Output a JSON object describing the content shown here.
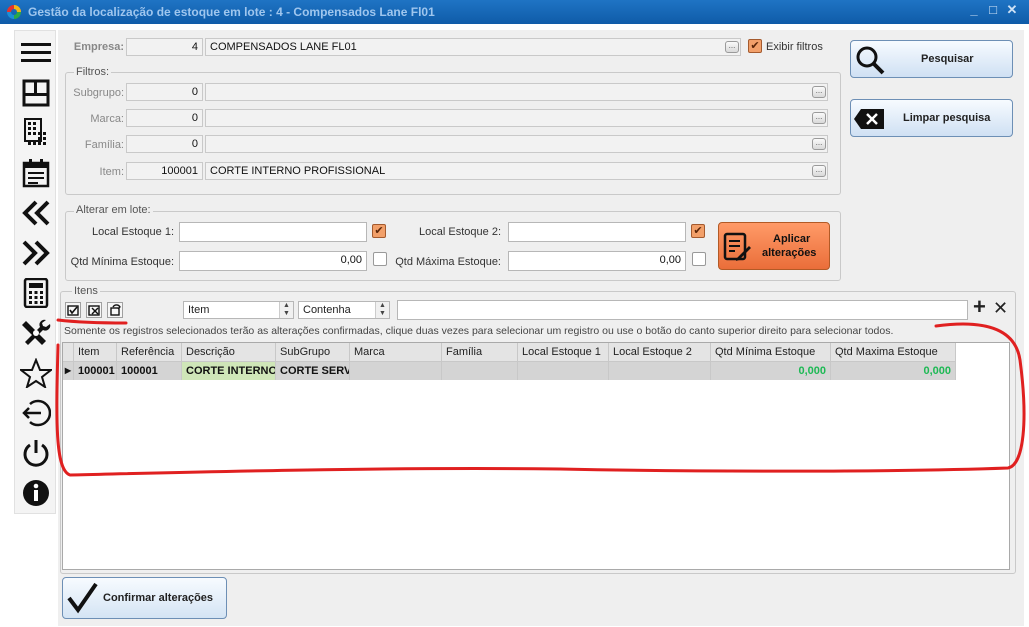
{
  "window": {
    "title": "Gestão da localização de estoque em lote : 4 - Compensados Lane Fl01",
    "controls": [
      "_",
      "□",
      "✕"
    ]
  },
  "sidebar": {
    "items": [
      {
        "name": "menu-icon"
      },
      {
        "name": "layout-icon"
      },
      {
        "name": "grid-calculator-icon"
      },
      {
        "name": "calendar-icon"
      },
      {
        "name": "double-chevron-left-icon"
      },
      {
        "name": "double-chevron-right-icon"
      },
      {
        "name": "calculator-icon"
      },
      {
        "name": "tools-icon"
      },
      {
        "name": "star-icon"
      },
      {
        "name": "exit-icon"
      },
      {
        "name": "power-icon"
      },
      {
        "name": "info-icon"
      }
    ]
  },
  "empresa": {
    "label": "Empresa:",
    "code": "4",
    "name": "COMPENSADOS LANE FL01",
    "show_filters_label": "Exibir filtros",
    "show_filters_checked": true
  },
  "filtros": {
    "title": "Filtros:",
    "subgrupo": {
      "label": "Subgrupo:",
      "code": "0",
      "desc": ""
    },
    "marca": {
      "label": "Marca:",
      "code": "0",
      "desc": ""
    },
    "familia": {
      "label": "Família:",
      "code": "0",
      "desc": ""
    },
    "item": {
      "label": "Item:",
      "code": "100001",
      "desc": "CORTE INTERNO PROFISSIONAL"
    }
  },
  "buttons": {
    "pesquisar": "Pesquisar",
    "limpar": "Limpar pesquisa",
    "aplicar_line1": "Aplicar",
    "aplicar_line2": "alterações",
    "confirmar": "Confirmar alterações"
  },
  "lote": {
    "title": "Alterar em lote:",
    "local1_label": "Local Estoque 1:",
    "local1_value": "",
    "local2_label": "Local Estoque 2:",
    "local2_value": "",
    "qtd_min_label": "Qtd Mínima Estoque:",
    "qtd_min_value": "0,00",
    "qtd_max_label": "Qtd Máxima Estoque:",
    "qtd_max_value": "0,00"
  },
  "itens": {
    "title": "Itens",
    "field_combo": "Item",
    "op_combo": "Contenha",
    "search_value": "",
    "notice": "Somente os registros selecionados terão as alterações confirmadas, clique duas vezes para selecionar um registro ou use o botão do canto superior direito para selecionar todos.",
    "columns": [
      "Item",
      "Referência",
      "Descrição",
      "SubGrupo",
      "Marca",
      "Família",
      "Local Estoque 1",
      "Local Estoque 2",
      "Qtd Mínima Estoque",
      "Qtd Maxima Estoque"
    ],
    "rows": [
      {
        "item": "100001",
        "referencia": "100001",
        "descricao": "CORTE INTERNO P",
        "subgrupo": "CORTE SERVI",
        "marca": "",
        "familia": "",
        "local1": "",
        "local2": "",
        "qtd_min": "0,000",
        "qtd_max": "0,000"
      }
    ]
  },
  "colors": {
    "titlebar": "#1565b8",
    "accent_orange": "#f08050",
    "annotation_red": "#e02020",
    "number_green": "#1db954"
  }
}
